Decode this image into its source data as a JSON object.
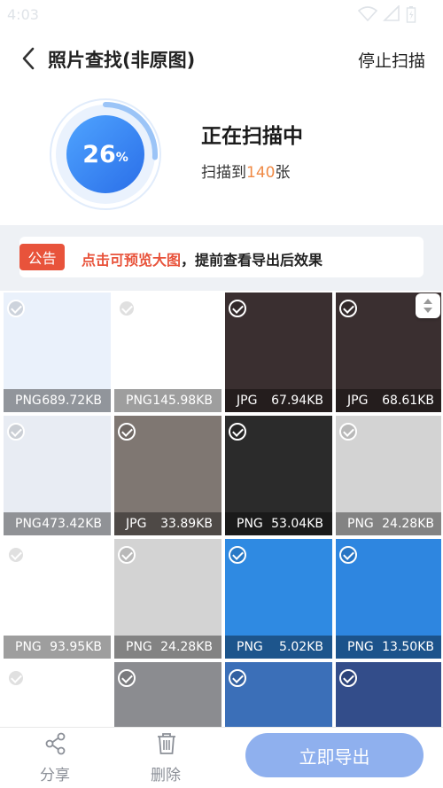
{
  "status_bar": {
    "time": "4:03"
  },
  "header": {
    "title": "照片查找(非原图)",
    "stop_label": "停止扫描"
  },
  "scan": {
    "percent_value": "26",
    "percent_sign": "%",
    "progress": 0.26,
    "title": "正在扫描中",
    "count_prefix": "扫描到",
    "count": "140",
    "count_suffix": "张"
  },
  "notice": {
    "tag": "公告",
    "highlight": "点击可预览大图",
    "rest": "，提前查看导出后效果"
  },
  "grid": {
    "items": [
      {
        "type": "PNG",
        "size": "689.72KB",
        "bg": "#eaf1fb"
      },
      {
        "type": "PNG",
        "size": "145.98KB",
        "bg": "#ffffff"
      },
      {
        "type": "JPG",
        "size": "67.94KB",
        "bg": "#3a2f30"
      },
      {
        "type": "JPG",
        "size": "68.61KB",
        "bg": "#3a2f30"
      },
      {
        "type": "PNG",
        "size": "473.42KB",
        "bg": "#e8ecf3"
      },
      {
        "type": "JPG",
        "size": "33.89KB",
        "bg": "#7f7772"
      },
      {
        "type": "PNG",
        "size": "53.04KB",
        "bg": "#2b2b2b"
      },
      {
        "type": "PNG",
        "size": "24.28KB",
        "bg": "#d3d3d3"
      },
      {
        "type": "PNG",
        "size": "93.95KB",
        "bg": "#ffffff"
      },
      {
        "type": "PNG",
        "size": "24.28KB",
        "bg": "#d3d3d3"
      },
      {
        "type": "PNG",
        "size": "5.02KB",
        "bg": "#2f8ae2"
      },
      {
        "type": "PNG",
        "size": "13.50KB",
        "bg": "#2e86e0"
      },
      {
        "type": "",
        "size": "",
        "bg": "#ffffff"
      },
      {
        "type": "",
        "size": "",
        "bg": "#8b8c90"
      },
      {
        "type": "",
        "size": "",
        "bg": "#3b6fb8"
      },
      {
        "type": "",
        "size": "",
        "bg": "#334d8a"
      }
    ]
  },
  "bottom": {
    "share": "分享",
    "delete": "删除",
    "export": "立即导出"
  },
  "colors": {
    "accent": "#2f73e8",
    "notice_red": "#e8533b",
    "count_orange": "#f08a45",
    "export_button": "#8fb0ee"
  }
}
